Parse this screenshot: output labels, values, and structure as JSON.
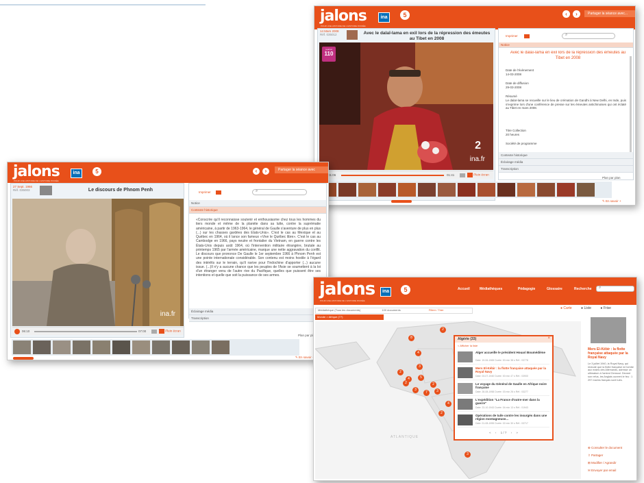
{
  "brand": {
    "logo": "jalons",
    "tagline": "POUR UNE HISTOIRE DE L'HISTOIRE PASSÉE",
    "ina_label": "ina",
    "five_label": "5"
  },
  "colors": {
    "accent": "#e8501a",
    "ina_blue": "#0a6fb8"
  },
  "win_top": {
    "header_link": "Partager la séance avec...",
    "date": "14 Mars 2008",
    "date_sub": "Réf. 035012",
    "title": "Avec le dalaï-lama en exil lors de la répression des émeutes au Tibet en 2008",
    "badge_line1": "journal",
    "badge_number": "110",
    "print_label": "Imprimer",
    "notice_label": "Notice",
    "heading": "Avec le dalaï-lama en exil lors de la répression des émeutes au Tibet en 2008",
    "event_label": "Date de l'évènement",
    "event_value": "14-03-2008",
    "broadcast_label": "Date de diffusion",
    "broadcast_value": "29-03-2008",
    "summary_label": "Résumé",
    "summary": "Le dalaï-lama se recueille sur le lieu de crémation de Gandhi à New Delhi, en Inde, puis s'exprime lors d'une conférence de presse sur les émeutes antichinoises qui ont éclaté au Tibet en mars 2008.",
    "collection_label": "Titre Collection",
    "collection_value": "20 heures",
    "society_label": "Société de programme",
    "sections": [
      "Contexte historique",
      "Éclairage média",
      "Transcription"
    ],
    "time_start": "01:06",
    "time_end": "01:41",
    "zoom": "Plein écran",
    "plan": "Plan par plan",
    "channel": "2",
    "watermark": "ina.fr",
    "footer": "En savoir +"
  },
  "win_left": {
    "header_link": "Partager la séance avec",
    "date": "27 Sept. 1966",
    "date_sub": "Réf. 035003",
    "title": "Le discours de Phnom Penh",
    "print_label": "Imprimer",
    "notice_label": "Notice",
    "context_label": "Contexte historique",
    "context_text": "«Conscrire qu'il reconnaisse soutenir et enthousiasme chez tous les hommes du tiers monde et même de la planète dans sa lutte, contre la suprématie américaine, à partir de 1963-1964, le général de Gaulle s'aventure de plus en plus (...) sur les chasses gardées des Etats-Unis». C'est le cas au Mexique et au Québec en 1964, où il lance son fameux «Vive le Québec libre». C'est le cas au Cambodge en 1966, pays neutre et frontalier du Vietnam, en guerre contre les États-Unis depuis août 1964, où l'intervention militaire étrangère, brutale au printemps 1965 par l'armée américaine, marque une nette aggravation du conflit. Le discours que prononce De Gaulle le 1er septembre 1966 à Phnom Penh est une pointe internationale considérable. Son contenu est moins hostile à l'égard des intérêts sur le terrain, qu'il ravive pour l'Indochine d'apporter (...) aucune issue. (...)Il n'y a aucune chance que les peuples de l'Asie se soumettent à la loi d'un étranger venu de l'autre rive du Pacifique, quelles que puissent être ses intentions et quelle que soit la puissance de ses armes.",
    "sections": [
      "Éclairage média",
      "Transcription"
    ],
    "time_start": "06:10",
    "time_end": "07:00",
    "zoom": "Plein écran",
    "plan": "Plan par plan",
    "watermark": "ina.fr",
    "footer": "En savoir +"
  },
  "win_map": {
    "menu": [
      "Accueil",
      "Médiathèques",
      "Pédagogie",
      "Glossaire",
      "Recherche"
    ],
    "view_tabs": [
      "Carte",
      "Liste",
      "Frise"
    ],
    "crumb": "Médiathèque (Tous les documents)",
    "crumb_count": "100 documents",
    "crumb_filter": "Filtrer / Trier",
    "subcrumb": "Monde > Afrique (77)",
    "sea_label": "ATLANTIQUE",
    "popup_title": "Algérie (33)",
    "popup_sub": "< Afficher la liste",
    "items": [
      {
        "title": "Alger accueille le président Houari Boumédiène",
        "meta": "Date: 19-06-1965   Durée: 00 min 38 s   Réf.: 03778"
      },
      {
        "title": "Mers El-Kébir : la flotte française attaquée par la Royal Navy",
        "meta": "Date: 03-07-1940   Durée: 00 min 47 s   Réf.: 03900"
      },
      {
        "title": "Le voyage du Général de Gaulle en Afrique noire française",
        "meta": "Date: 28-08-1958   Durée: 03 min 26 s   Réf.: 03277"
      },
      {
        "title": "L'expédition \"La France d'outre-mer dans la guerre\"",
        "meta": "Date: 23-10-1943   Durée: 04 min 13 s   Réf.: 01943"
      },
      {
        "title": "Opérations de tuile contre les insurgés dans une région montagneuse...",
        "meta": "Date: 01-08-1955   Durée: 02 min 30 s   Réf.: 03717"
      }
    ],
    "pager": "1 / 7",
    "side_title": "Mers El-Kébir : la flotte française attaquée par la Royal Navy",
    "side_text": "Le 3 juillet 1940, la Royal Navy, qui redoute que la flotte française ne tombe aux mains des Allemands, adresse un ultimatum à l'amiral Gensoul. Devant son refus, les Anglais ouvrent le feu : 1 297 marins français sont tués.",
    "side_links": [
      "Consulter le document",
      "Partager",
      "Modifier / Agrandir",
      "Envoyer par email"
    ],
    "pins": [
      "8",
      "2",
      "4",
      "2",
      "3",
      "4",
      "5",
      "2",
      "3",
      "7",
      "3",
      "2",
      "4",
      "2",
      "3"
    ]
  }
}
